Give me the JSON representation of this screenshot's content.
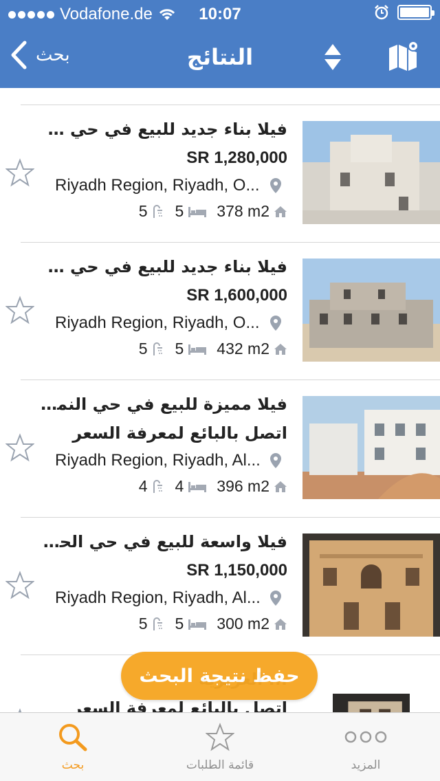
{
  "status_bar": {
    "carrier": "Vodafone.de",
    "time": "10:07"
  },
  "nav": {
    "back_label": "بحث",
    "title": "النتائج"
  },
  "colors": {
    "header": "#4a7ec6",
    "accent": "#f39a1e",
    "save_button": "#f6a623"
  },
  "listings": [
    {
      "title": "فيلا بناء جديد للبيع في حي عكا...",
      "price": "SR 1,280,000",
      "location": "Riyadh Region, Riyadh, O...",
      "bathrooms": "5",
      "bedrooms": "5",
      "area": "378 m2"
    },
    {
      "title": "فيلا بناء جديد للبيع في حي عكا...",
      "price": "SR 1,600,000",
      "location": "Riyadh Region, Riyadh, O...",
      "bathrooms": "5",
      "bedrooms": "5",
      "area": "432 m2"
    },
    {
      "title": "فيلا مميزة للبيع في حي النمار ,...",
      "price": "اتصل بالبائع لمعرفة السعر",
      "location": "Riyadh Region, Riyadh, Al...",
      "bathrooms": "4",
      "bedrooms": "4",
      "area": "396 m2"
    },
    {
      "title": "فيلا واسعة للبيع في حي الحزم ,...",
      "price": "SR 1,150,000",
      "location": "Riyadh Region, Riyadh, Al...",
      "bathrooms": "5",
      "bedrooms": "5",
      "area": "300 m2"
    },
    {
      "title": "... العزيزية",
      "price": "اتصل بالبائع لمعرفة السعر"
    }
  ],
  "save_search_button": "حفظ نتيجة البحث",
  "tabs": [
    {
      "label": "بحث",
      "icon": "search-icon"
    },
    {
      "label": "قائمة الطلبات",
      "icon": "star-icon"
    },
    {
      "label": "المزيد",
      "icon": "more-icon"
    }
  ]
}
